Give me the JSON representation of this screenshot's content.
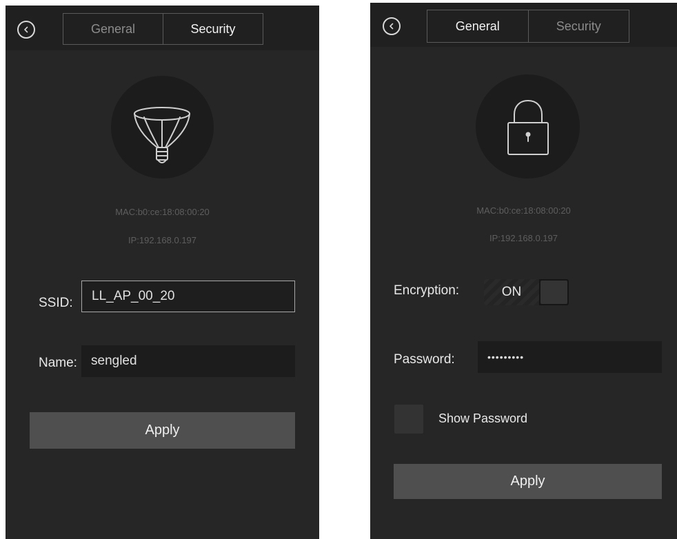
{
  "general_screen": {
    "tabs": [
      "General",
      "Security"
    ],
    "active_tab": "Security",
    "device_icon": "light-bulb-icon",
    "mac": "MAC:b0:ce:18:08:00:20",
    "ip": "IP:192.168.0.197",
    "ssid_label": "SSID:",
    "ssid_value": "LL_AP_00_20",
    "name_label": "Name:",
    "name_value": "sengled",
    "apply_label": "Apply"
  },
  "security_screen": {
    "tabs": [
      "General",
      "Security"
    ],
    "active_tab": "General",
    "device_icon": "padlock-icon",
    "mac": "MAC:b0:ce:18:08:00:20",
    "ip": "IP:192.168.0.197",
    "encryption_label": "Encryption:",
    "encryption_state": "ON",
    "password_label": "Password:",
    "password_value": "•••••••••",
    "show_password_label": "Show Password",
    "show_password_checked": false,
    "apply_label": "Apply"
  },
  "colors": {
    "screen_bg": "#262626",
    "topbar_bg": "#202020",
    "button_bg": "#4f4f4f",
    "field_bg": "#1c1c1c",
    "text": "#e8e8e8",
    "muted_text": "#5e5e5e"
  }
}
